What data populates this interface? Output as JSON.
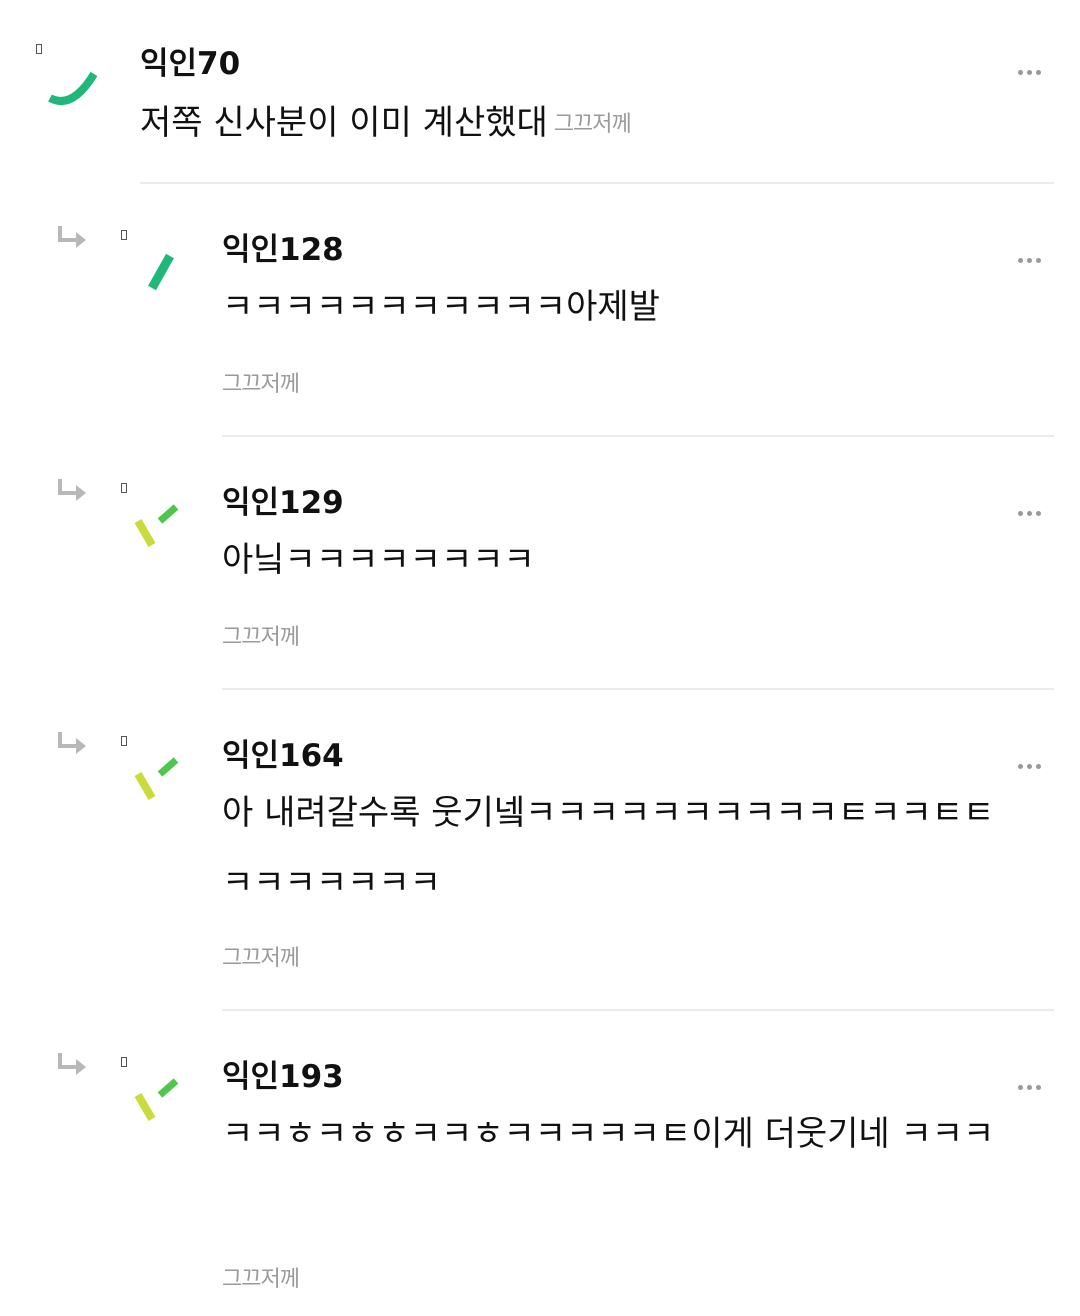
{
  "comments": [
    {
      "nick": "익인70",
      "text": "저쪽 신사분이 이미 계산했대",
      "time": "그끄저께",
      "is_reply": false
    },
    {
      "nick": "익인128",
      "text": "ㅋㅋㅋㅋㅋㅋㅋㅋㅋㅋㅋ아제발",
      "time": "그끄저께",
      "is_reply": true
    },
    {
      "nick": "익인129",
      "text": "아닠ㅋㅋㅋㅋㅋㅋㅋㅋ",
      "time": "그끄저께",
      "is_reply": true
    },
    {
      "nick": "익인164",
      "text": "아 내려갈수록 웃기넼ㅋㅋㅋㅋㅋㅋㅋㅋㅋㅋㅌㅋㅋㅌㅌㅋㅋㅋㅋㅋㅋㅋ",
      "time": "그끄저께",
      "is_reply": true
    },
    {
      "nick": "익인193",
      "text": "ㅋㅋㅎㅋㅎㅎㅋㅋㅎㅋㅋㅋㅋㅋㅌ이게 더웃기네 ㅋㅋㅋ",
      "time": "그끄저께",
      "is_reply": true
    }
  ],
  "icons": {
    "reply_arrow": "reply-arrow-icon",
    "more": "more-horizontal-icon",
    "badge": "badge-icon"
  },
  "colors": {
    "nick": "#111111",
    "time": "#9a9a9a",
    "divider": "#ebebeb",
    "avatar_green": "#1fb87a",
    "avatar_lime": "#c9dc3c",
    "avatar_leaf": "#4cc64b"
  }
}
